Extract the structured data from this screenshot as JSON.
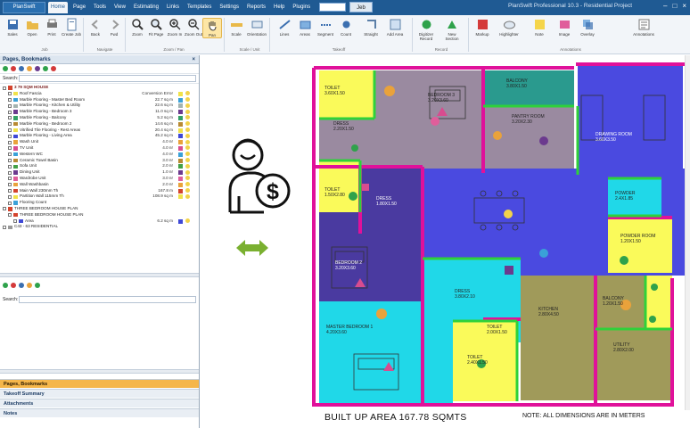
{
  "app": {
    "button": "PlanSwift",
    "window_title": "PlanSwift Professional 10.3 - Residential Project",
    "menu": [
      "Home",
      "Page",
      "Tools",
      "View",
      "Estimating",
      "Links",
      "Templates",
      "Settings",
      "Reports",
      "Help",
      "Plugins"
    ],
    "active_menu": "Home",
    "go_label": "Jeb"
  },
  "ribbon": {
    "tools": [
      "Sales",
      "Open",
      "Print",
      "Create Job",
      "Back",
      "Fwd",
      "Zoom",
      "Fit Page",
      "Zoom In",
      "Zoom Out",
      "Pan",
      "Scale",
      "Orientation",
      "Lines",
      "Areas",
      "Segment",
      "Count",
      "Straight",
      "Add Area",
      "Digitizer Record",
      "New Section",
      "Markup",
      "Highlighter",
      "Note",
      "Image",
      "Overlay",
      "Annotations"
    ],
    "groups": [
      "Job",
      "Navigate",
      "Zoom / Pan",
      "Scale / Unit",
      "Takeoff",
      "Record",
      "Annotations"
    ]
  },
  "left_panel": {
    "header": "Pages, Bookmarks",
    "search_label": "Search:",
    "tree": [
      {
        "name": "3 79 SQM HOUSE",
        "value": "",
        "color": "#d4442e",
        "level": 0,
        "bold": true
      },
      {
        "name": "Roof Fascia",
        "value": "Conversion Error",
        "color": "#f0e24a",
        "level": 1
      },
      {
        "name": "Marble Flooring - Master Bed Room",
        "value": "22.7 sq m",
        "color": "#3aa1d8",
        "level": 1
      },
      {
        "name": "Marble Flooring - Kitchen & Utility",
        "value": "22.6 sq m",
        "color": "#a3b3b0",
        "level": 1
      },
      {
        "name": "Marble Flooring - Bedroom 3",
        "value": "11.0 sq m",
        "color": "#6b3a8e",
        "level": 1
      },
      {
        "name": "Marble Flooring - Balcony",
        "value": "5.2 sq m",
        "color": "#33a064",
        "level": 1
      },
      {
        "name": "Marble Flooring - Bedroom 2",
        "value": "14.6 sq m",
        "color": "#b88a33",
        "level": 1
      },
      {
        "name": "Vitrified Tile Flooring - Rest Areas",
        "value": "20.4 sq m",
        "color": "#f0e24a",
        "level": 1
      },
      {
        "name": "Marble Flooring - Living Area",
        "value": "45.2 sq m",
        "color": "#3e48d6",
        "level": 1
      },
      {
        "name": "Wash Unit",
        "value": "4.0 nr",
        "color": "#e9a23b",
        "level": 1
      },
      {
        "name": "TV Unit",
        "value": "4.0 nr",
        "color": "#d84c8f",
        "level": 1
      },
      {
        "name": "Western WC",
        "value": "4.0 nr",
        "color": "#3aa1d8",
        "level": 1
      },
      {
        "name": "Ceramic Towel Basin",
        "value": "3.0 nr",
        "color": "#b88a33",
        "level": 1
      },
      {
        "name": "Sofa Unit",
        "value": "2.0 nr",
        "color": "#43a046",
        "level": 1
      },
      {
        "name": "Dining Unit",
        "value": "1.0 nr",
        "color": "#6b3a8e",
        "level": 1
      },
      {
        "name": "Wardrobe Unit",
        "value": "3.0 nr",
        "color": "#e05e9b",
        "level": 1
      },
      {
        "name": "Wall Washbasin",
        "value": "2.0 nr",
        "color": "#e9a23b",
        "level": 1
      },
      {
        "name": "Main Wall 230mm Th",
        "value": "167.8 m",
        "color": "#d4442e",
        "level": 1
      },
      {
        "name": "Partition Wall 115mm Th",
        "value": "108.9 sq m",
        "color": "#f0e24a",
        "level": 1
      },
      {
        "name": "Flooring Count",
        "value": "",
        "color": "#3aa1d8",
        "level": 1
      },
      {
        "name": "THREE BEDROOM HOUSE PLAN",
        "value": "",
        "color": "#d4442e",
        "level": 0
      },
      {
        "name": "THREE BEDROOM HOUSE PLAN",
        "value": "",
        "color": "#d4442e",
        "level": 1
      },
      {
        "name": "Area",
        "value": "6.2 sq m",
        "color": "#3e48d6",
        "level": 2
      },
      {
        "name": "C43 - 63 RESIDENTIAL",
        "value": "",
        "color": "#999999",
        "level": 0
      }
    ],
    "lower_search_label": "Search:",
    "accordions": [
      "Pages, Bookmarks",
      "Takeoff Summary",
      "Attachments",
      "Notes"
    ]
  },
  "plan": {
    "rooms": [
      {
        "label": "BALCONY",
        "dims": "3.80X1.50"
      },
      {
        "label": "TOILET",
        "dims": "3.60X1.50"
      },
      {
        "label": "BEDROOM 3",
        "dims": "3.20X3.60"
      },
      {
        "label": "DRESS",
        "dims": "2.20X1.50"
      },
      {
        "label": "PANTRY ROOM",
        "dims": "3.20X2.30"
      },
      {
        "label": "BALCONY",
        "dims": "1.20X1.50"
      },
      {
        "label": "DRAWING ROOM",
        "dims": "3.60X3.50"
      },
      {
        "label": "TOILET",
        "dims": "1.50X2.80"
      },
      {
        "label": "DRESS",
        "dims": "1.80X1.50"
      },
      {
        "label": "POWDER",
        "dims": "2.4X1.85"
      },
      {
        "label": "POWDER ROOM",
        "dims": "1.20X1.50"
      },
      {
        "label": "BEDROOM 2",
        "dims": "3.20X3.60"
      },
      {
        "label": "DRESS",
        "dims": "3.80X2.10"
      },
      {
        "label": "MASTER BEDROOM 1",
        "dims": "4.20X3.60"
      },
      {
        "label": "TOILET",
        "dims": "2.40X1.50"
      },
      {
        "label": "TOILET",
        "dims": "2.00X1.50"
      },
      {
        "label": "KITCHEN",
        "dims": "2.80X4.50"
      },
      {
        "label": "UTILITY",
        "dims": "2.80X2.00"
      }
    ],
    "built_up": "BUILT UP AREA 167.78 SQMTS",
    "note": "NOTE: ALL DIMENSIONS ARE IN METERS"
  },
  "colors": {
    "ribbon_blue": "#1f5a93",
    "accent_orange": "#f5b64a",
    "wall_magenta": "#e0119a",
    "living_blue": "#4a4ae0",
    "master_cyan": "#20d8e8",
    "toilet_yellow": "#fafa5a",
    "kitchen_olive": "#a09a5a",
    "bedroom_purple": "#4a3aa0",
    "pantry_grey": "#9a8aa0",
    "balcony_teal": "#2a9a8e",
    "arrow_green": "#7ab030"
  }
}
